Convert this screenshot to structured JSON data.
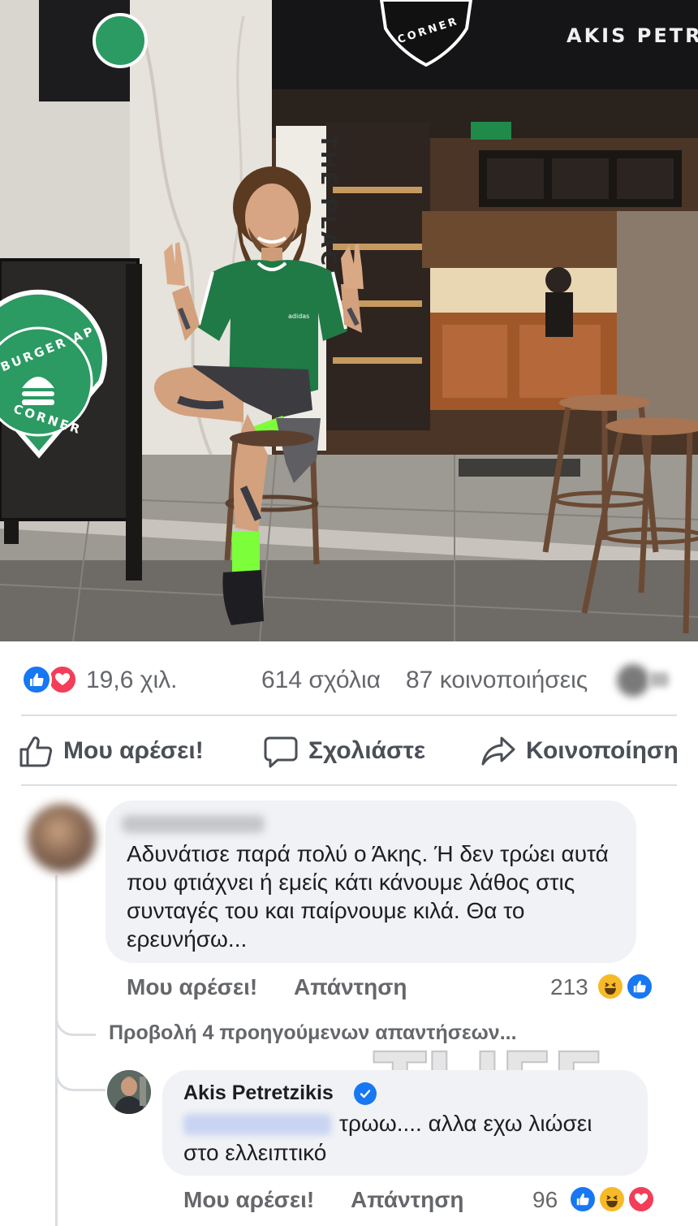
{
  "photo": {
    "storefront_sign": "AKIS PETR",
    "board_logo": {
      "top": "BURGER AP",
      "bottom": "CORNER"
    },
    "header_logo": "CORNER",
    "shelf_sign": "THE PLACE",
    "shirt_brand": "adidas",
    "colors": {
      "logo_green": "#2c9a63",
      "sock_green": "#7cff3a",
      "shirt_green": "#1f7a45"
    }
  },
  "post_stats": {
    "reaction_icons": [
      "like-icon",
      "love-icon"
    ],
    "reactions": "19,6 χιλ.",
    "comments": "614 σχόλια",
    "shares": "87 κοινοποιήσεις"
  },
  "actions": {
    "like": "Μου αρέσει!",
    "comment": "Σχολιάστε",
    "share": "Κοινοποίηση"
  },
  "comment1": {
    "text": "Αδυνάτισε παρά πολύ ο Άκης. Ή δεν τρώει αυτά που φτιάχνει ή εμείς κάτι κάνουμε λάθος στις συνταγές του και παίρνουμε κιλά. Θα το ερευνήσω...",
    "like": "Μου αρέσει!",
    "reply": "Απάντηση",
    "reaction_count": "213",
    "reaction_icons": [
      "haha-icon",
      "like-icon"
    ]
  },
  "previous_replies": "Προβολή 4 προηγούμενων απαντήσεων...",
  "comment2": {
    "author": "Akis Petretzikis",
    "text_line1": "τρωω.... αλλα εχω λιώσει",
    "text_line2": "στο ελλειπτικό",
    "like": "Μου αρέσει!",
    "reply": "Απάντηση",
    "reaction_count": "96",
    "reaction_icons": [
      "like-icon",
      "haha-icon",
      "love-icon"
    ]
  },
  "watermark": "TLIFE",
  "colors": {
    "facebook_blue": "#1877f2",
    "love_red": "#f33e58",
    "haha_yellow": "#f7b928",
    "meta_grey": "#65676b"
  }
}
